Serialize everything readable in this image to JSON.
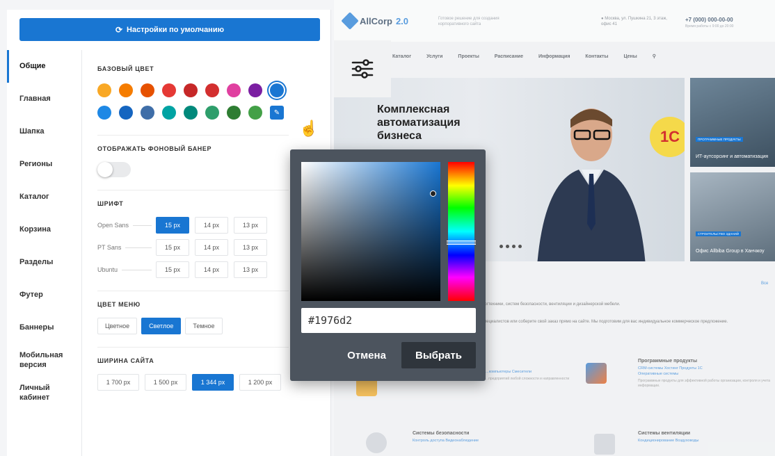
{
  "panel": {
    "reset_label": "Настройки по умолчанию",
    "tabs": [
      {
        "label": "Общие"
      },
      {
        "label": "Главная"
      },
      {
        "label": "Шапка"
      },
      {
        "label": "Регионы"
      },
      {
        "label": "Каталог"
      },
      {
        "label": "Корзина"
      },
      {
        "label": "Разделы"
      },
      {
        "label": "Футер"
      },
      {
        "label": "Баннеры"
      },
      {
        "label": "Мобильная версия"
      },
      {
        "label": "Личный кабинет"
      }
    ],
    "base_color": {
      "title": "БАЗОВЫЙ ЦВЕТ",
      "swatches_row1": [
        "#f9a825",
        "#f57c00",
        "#e65100",
        "#e53935",
        "#c62828",
        "#d32f2f",
        "#e040a0",
        "#7b1fa2",
        "#1976d2"
      ],
      "swatches_row2": [
        "#1e88e5",
        "#1565c0",
        "#3f6ea8",
        "#00a3a3",
        "#00897b",
        "#2e9e6b",
        "#2e7d32",
        "#43a047"
      ],
      "selected_color": "#1976d2"
    },
    "banner": {
      "title": "ОТОБРАЖАТЬ ФОНОВЫЙ БАНЕР",
      "enabled": false
    },
    "font": {
      "title": "ШРИФТ",
      "rows": [
        {
          "name": "Open Sans",
          "sizes": [
            "15 px",
            "14 px",
            "13 px"
          ],
          "active": 0
        },
        {
          "name": "PT Sans",
          "sizes": [
            "15 px",
            "14 px",
            "13 px"
          ],
          "active": -1
        },
        {
          "name": "Ubuntu",
          "sizes": [
            "15 px",
            "14 px",
            "13 px"
          ],
          "active": -1
        }
      ]
    },
    "menu_color": {
      "title": "ЦВЕТ МЕНЮ",
      "options": [
        "Цветное",
        "Светлое",
        "Темное"
      ],
      "active": 1
    },
    "site_width": {
      "title": "ШИРИНА САЙТА",
      "options": [
        "1 700 px",
        "1 500 px",
        "1 344 px",
        "1 200 px"
      ],
      "active": 2
    }
  },
  "picker": {
    "hex_value": "#1976d2",
    "cancel_label": "Отмена",
    "choose_label": "Выбрать"
  },
  "site": {
    "logo_text": "AllCorp",
    "logo_version": "2.0",
    "tagline": "Готовое решение для создания корпоративного сайта",
    "address": "Москва, ул. Пушкина 21, 3 этаж, офис 41",
    "phone": "+7 (000) 000-00-00",
    "phone_hours": "Время работы с 9:00 до 20:00",
    "nav": [
      "Каталог",
      "Услуги",
      "Проекты",
      "Расписание",
      "Информация",
      "Контакты",
      "Цены"
    ],
    "hero_title_1": "Комплексная",
    "hero_title_2": "автоматизация",
    "hero_title_3": "бизнеса",
    "onec_label": "1С",
    "card1_tag": "Программные продукты",
    "card1_text": "ИТ-аутсорсинг и автоматизация",
    "card2_tag": "Строительство зданий",
    "card2_text": "Офис Allbiba Group в Ханчжоу",
    "all_link": "Все",
    "body_line1": "...оргтехники, систем безопасности, вентиляции и дизайнерской мебели.",
    "body_line2": "...специалистов или соберите свой заказ прямо на сайте. Мы подготовим для вас индивидуальное коммерческое предложение.",
    "categories": [
      {
        "title": "Программные продукты",
        "links": "CRM-системы   Хостинг   Продукты 1С",
        "sub": "Оперативные системы",
        "desc": "Программные продукты для эффективной работы организации, контроля и учета информации."
      },
      {
        "title": "Системы безопасности",
        "links": "Контроль доступа   Видеонаблюдение",
        "desc": ""
      },
      {
        "title": "Системы вентиляции",
        "links": "Кондиционирование   Воздуховоды",
        "desc": ""
      }
    ],
    "cat_left_links": "...компьютеры   Смесители",
    "cat_left_desc": "...предприятий любой сложности и направленности"
  }
}
